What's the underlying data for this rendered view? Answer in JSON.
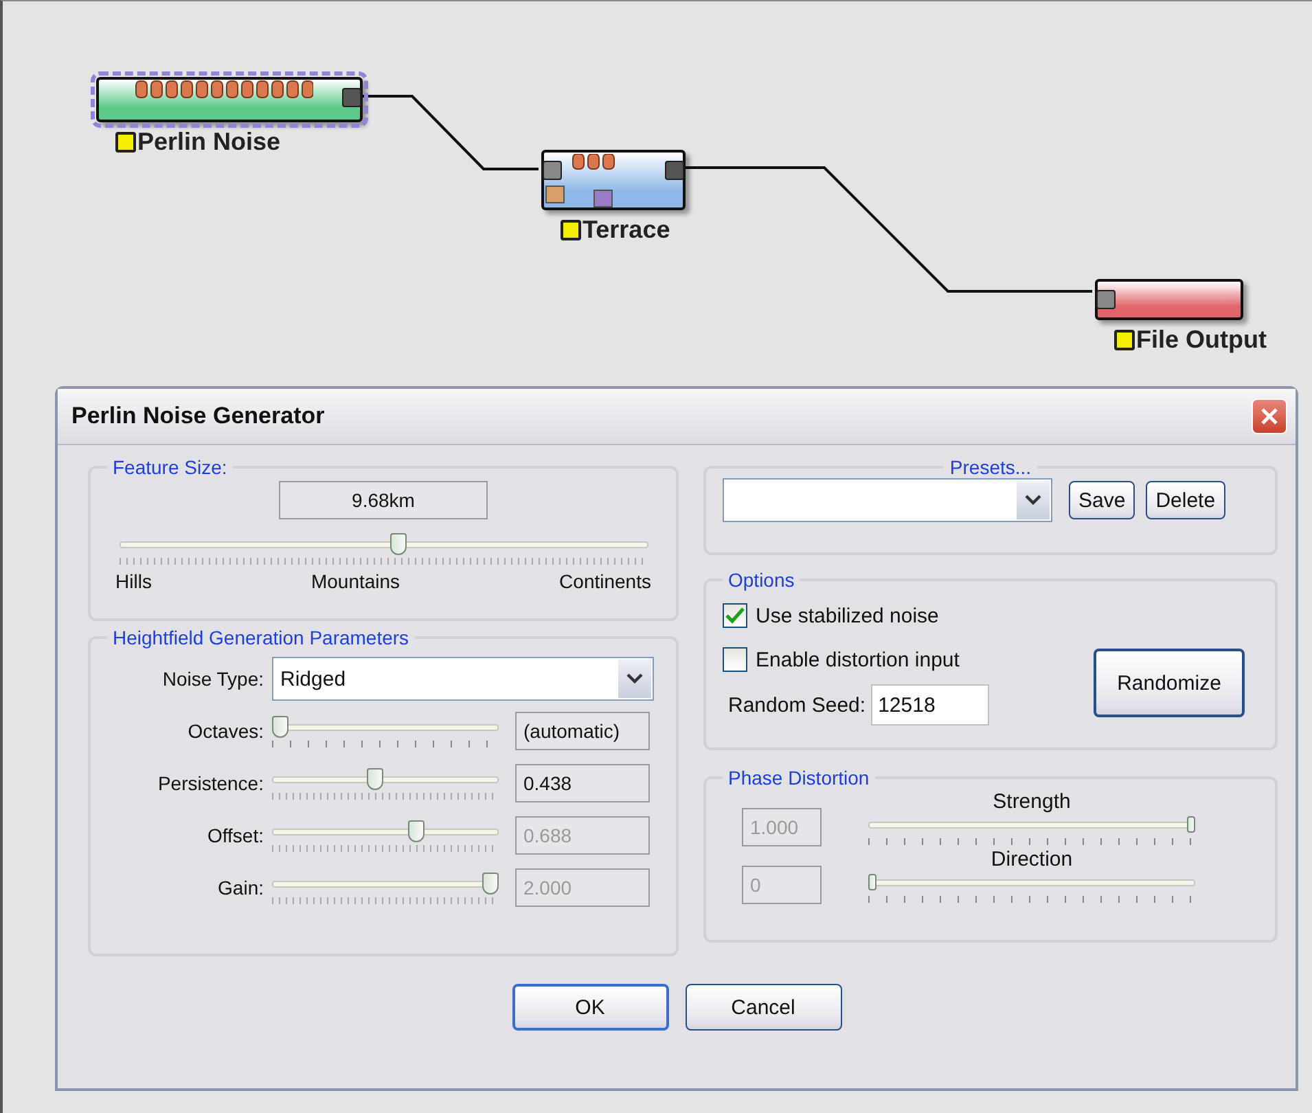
{
  "graph": {
    "nodes": [
      {
        "label": "Perlin Noise",
        "kind": "generator",
        "color": "#5cc98a",
        "selected": true
      },
      {
        "label": "Terrace",
        "kind": "filter",
        "color": "#8fb8e8",
        "selected": false
      },
      {
        "label": "File Output",
        "kind": "output",
        "color": "#e0656b",
        "selected": false
      }
    ]
  },
  "dialog": {
    "title": "Perlin Noise Generator",
    "feature_size": {
      "legend": "Feature Size:",
      "value": "9.68km",
      "level": 0.53,
      "labels": [
        "Hills",
        "Mountains",
        "Continents"
      ]
    },
    "heightfield": {
      "legend": "Heightfield Generation Parameters",
      "noise_type": {
        "label": "Noise Type:",
        "value": "Ridged"
      },
      "params": [
        {
          "label": "Octaves:",
          "level": 0,
          "value": "(automatic)",
          "disabled": false
        },
        {
          "label": "Persistence:",
          "level": 0.45,
          "value": "0.438",
          "disabled": false
        },
        {
          "label": "Offset:",
          "level": 0.65,
          "value": "0.688",
          "disabled": true
        },
        {
          "label": "Gain:",
          "level": 1,
          "value": "2.000",
          "disabled": true
        }
      ]
    },
    "presets": {
      "legend": "Presets...",
      "buttons": [
        "Save",
        "Delete"
      ]
    },
    "options": {
      "legend": "Options",
      "checkboxes": [
        {
          "label": "Use stabilized noise",
          "checked": true
        },
        {
          "label": "Enable distortion input",
          "checked": false
        }
      ],
      "seed": {
        "label": "Random Seed:",
        "value": "12518"
      },
      "randomize": "Randomize"
    },
    "phase": {
      "legend": "Phase Distortion",
      "rows": [
        {
          "label": "Strength",
          "value": "1.000",
          "level": 1
        },
        {
          "label": "Direction",
          "value": "0",
          "level": 0
        }
      ]
    },
    "buttons": [
      {
        "label": "OK",
        "default": true
      },
      {
        "label": "Cancel",
        "default": false
      }
    ]
  }
}
